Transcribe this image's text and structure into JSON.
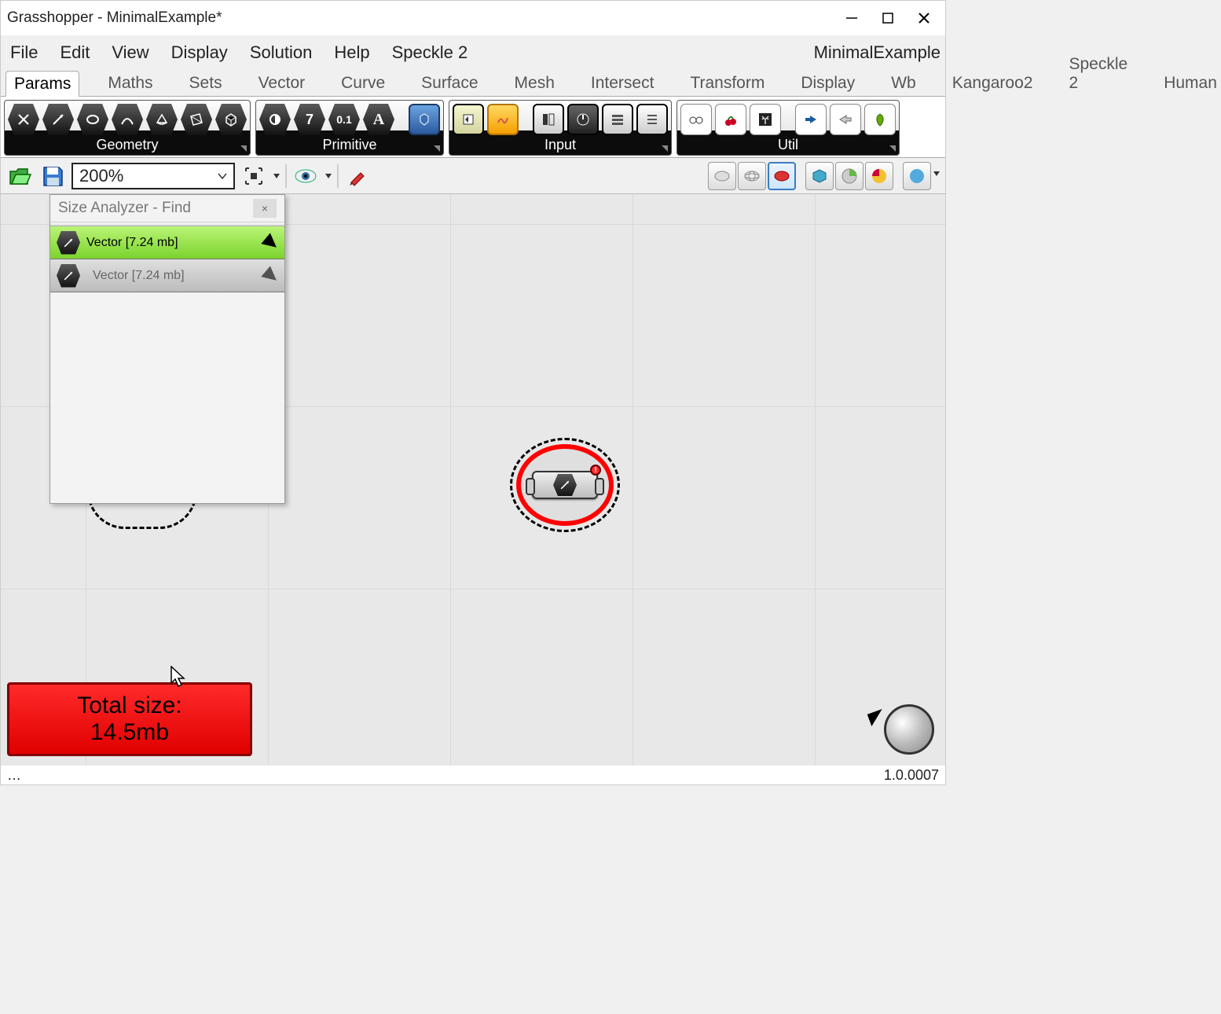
{
  "title": "Grasshopper - MinimalExample*",
  "doc_label": "MinimalExample",
  "menu": [
    "File",
    "Edit",
    "View",
    "Display",
    "Solution",
    "Help",
    "Speckle 2"
  ],
  "tabs": [
    "Params",
    "Maths",
    "Sets",
    "Vector",
    "Curve",
    "Surface",
    "Mesh",
    "Intersect",
    "Transform",
    "Display",
    "Wb",
    "Kangaroo2",
    "Speckle 2",
    "Human"
  ],
  "selected_tab": "Params",
  "ribbon_groups": {
    "geometry": {
      "label": "Geometry"
    },
    "primitive": {
      "label": "Primitive"
    },
    "input": {
      "label": "Input"
    },
    "util": {
      "label": "Util"
    }
  },
  "zoom": "200%",
  "panel": {
    "title": "Size Analyzer - Find",
    "items": [
      {
        "label": "Vector [7.24 mb]",
        "selected": true
      },
      {
        "label": "Vector [7.24 mb]",
        "selected": false
      }
    ]
  },
  "total_size": {
    "label": "Total size:",
    "value": "14.5mb"
  },
  "status_left": "…",
  "version": "1.0.0007",
  "colors": {
    "selection_green": "#8de24f",
    "alert_red": "#ff0d0d"
  }
}
